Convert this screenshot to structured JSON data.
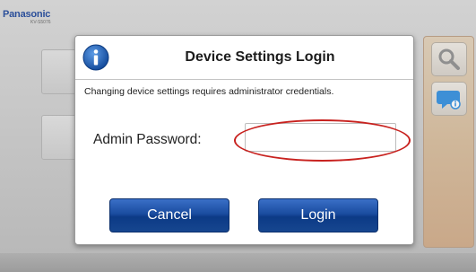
{
  "app": {
    "brand": "Panasonic",
    "model": "KV-S5076"
  },
  "dialog": {
    "title": "Device Settings Login",
    "message": "Changing device settings requires administrator credentials.",
    "password_label": "Admin Password:",
    "password_value": "",
    "cancel_label": "Cancel",
    "login_label": "Login"
  },
  "colors": {
    "brand": "#2b4f9a",
    "button": "#1a4c9f",
    "highlight": "#c8221f",
    "info_icon": "#1f5fb8"
  },
  "icons": [
    "info-icon",
    "search-icon",
    "chat-info-icon"
  ]
}
